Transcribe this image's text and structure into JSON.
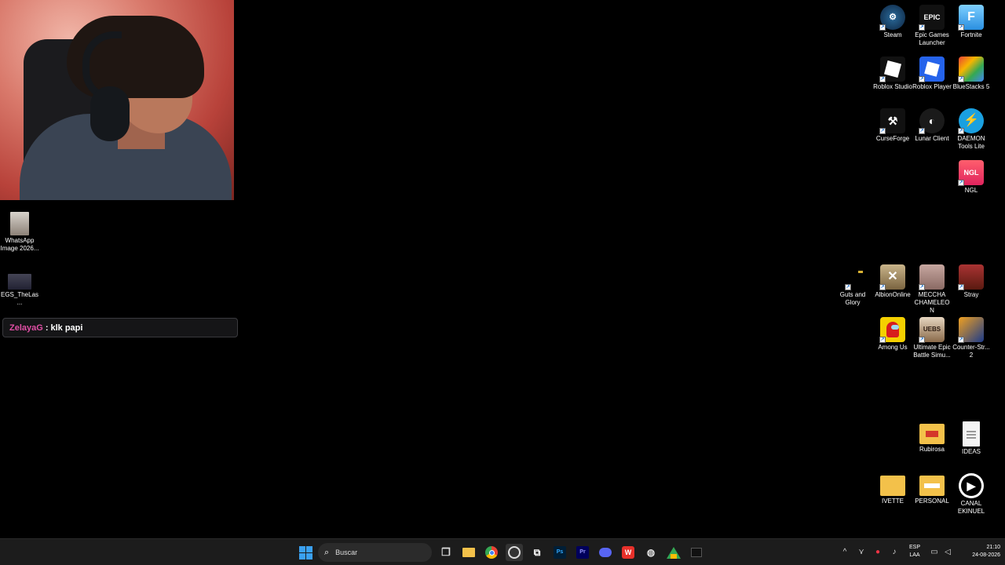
{
  "chat": {
    "username": "ZelayaG",
    "separator": ":",
    "message": "klk papi"
  },
  "desktop_left": [
    {
      "name": "whatsapp-image",
      "label": "WhatsApp Image 2026..."
    },
    {
      "name": "egs-thelas",
      "label": "EGS_TheLas..."
    }
  ],
  "desktop_right": [
    {
      "name": "steam",
      "label": "Steam"
    },
    {
      "name": "epic-games",
      "label": "Epic Games Launcher",
      "glyph": "EPIC"
    },
    {
      "name": "fortnite",
      "label": "Fortnite",
      "glyph": "F"
    },
    {
      "name": "roblox-studio",
      "label": "Roblox Studio"
    },
    {
      "name": "roblox-player",
      "label": "Roblox Player"
    },
    {
      "name": "bluestacks",
      "label": "BlueStacks 5"
    },
    {
      "name": "curseforge",
      "label": "CurseForge"
    },
    {
      "name": "lunar-client",
      "label": "Lunar Client"
    },
    {
      "name": "daemon-tools",
      "label": "DAEMON Tools Lite"
    },
    {
      "name": "ngl",
      "label": "NGL",
      "glyph": "NGL"
    },
    {
      "name": "guts-and-glory",
      "label": "Guts and Glory"
    },
    {
      "name": "albion-online",
      "label": "AlbionOnline"
    },
    {
      "name": "meccha-chameleon",
      "label": "MECCHA CHAMELEON"
    },
    {
      "name": "stray",
      "label": "Stray"
    },
    {
      "name": "among-us",
      "label": "Among Us"
    },
    {
      "name": "uebs2",
      "label": "Ultimate Epic Battle Simu...",
      "glyph": "UEBS"
    },
    {
      "name": "counter-strike",
      "label": "Counter-Str... 2"
    },
    {
      "name": "rubirosa",
      "label": "Rubirosa"
    },
    {
      "name": "ideas",
      "label": "IDEAS"
    },
    {
      "name": "ivette",
      "label": "IVETTE"
    },
    {
      "name": "personal",
      "label": "PERSONAL"
    },
    {
      "name": "canal-ekinuel",
      "label": "CANAL EKINUEL"
    }
  ],
  "taskbar": {
    "search_placeholder": "Buscar",
    "lang_line1": "ESP",
    "lang_line2": "LAA",
    "time": "21:10",
    "date": "24-08-2026"
  }
}
